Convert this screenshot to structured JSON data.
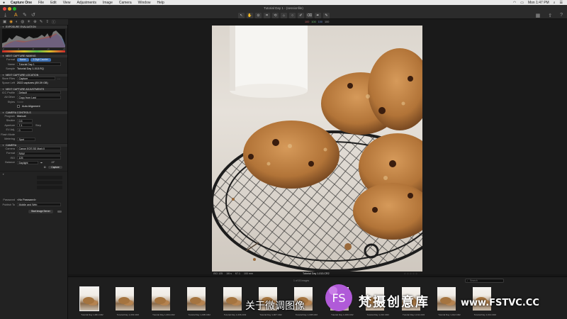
{
  "menubar": {
    "app_name": "Capture One",
    "items": [
      "File",
      "Edit",
      "View",
      "Adjustments",
      "Image",
      "Camera",
      "Window",
      "Help"
    ],
    "clock": "Mon 1:47 PM"
  },
  "window": {
    "title": "Tutorial Day 1 - (sessionfile)"
  },
  "colors": {
    "accent": "#f0a02a",
    "close": "#e0443e",
    "minimize": "#dea123",
    "zoom": "#1aab29",
    "format_pill": "#3c6fb3"
  },
  "viewer": {
    "readout": [
      "100",
      "100",
      "100",
      "100"
    ],
    "photo_meta": [
      "ISO 125",
      "1/6 s",
      "f/7.1",
      "100 mm"
    ],
    "filename": "Tutorial Day 1-013.CR2",
    "rating": "☆☆☆☆☆"
  },
  "left_panel": {
    "exposure_evaluation": "EXPOSURE EVALUATION",
    "hist_scale": [
      "-2",
      "-1",
      "0",
      "+1",
      "+2"
    ],
    "next_capture_naming": {
      "title": "NEXT CAPTURE NAMING",
      "format_label": "Format",
      "format_pill_1": "Name",
      "format_pill_2": "3 Digit Counter",
      "name_label": "Name",
      "name_value": "Tutorial Day 1",
      "sample_label": "Sample",
      "sample_value": "Tutorial Day 1-013.RQ"
    },
    "next_capture_location": {
      "title": "NEXT CAPTURE LOCATION",
      "store_label": "Store Files",
      "store_value": "Capture",
      "space_label": "Space Left",
      "space_value": "2022 captures (89.39 GB)"
    },
    "next_capture_adjustments": {
      "title": "NEXT CAPTURE ADJUSTMENTS",
      "icc_label": "ICC Profile",
      "icc_value": "Default",
      "all_other_label": "All Other",
      "all_other_value": "Copy from Last",
      "styles_label": "Styles",
      "styles_value": "None",
      "auto_alignment": "Auto Alignment"
    },
    "camera_controls": {
      "title": "CAMERA CONTROLS",
      "program_label": "Program",
      "program_value": "Manual",
      "shutter_label": "Shutter",
      "shutter_value": "0.5",
      "aperture_label": "Aperture",
      "aperture_value": "7.1",
      "step_label": "Step",
      "ev_label": "EV Adj.",
      "ev_value": "0",
      "flash_label": "Flash Mode",
      "metering_label": "Metering",
      "metering_value": "Spot"
    },
    "camera": {
      "title": "CAMERA",
      "camera_label": "Camera",
      "camera_value": "Canon EOS 5D Mark II",
      "format_label": "Format",
      "format_value": "RAW",
      "iso_label": "ISO",
      "iso_value": "125",
      "balance_label": "Balance",
      "balance_value": "Daylight",
      "af_label": "AF",
      "capture_button": "Capture"
    },
    "publish": {
      "password_label": "Password",
      "password_value": "<No Password>",
      "publish_label": "Publish To",
      "publish_value": "Mobile and Web",
      "start_button": "Start Image Server"
    }
  },
  "filmstrip": {
    "header": "1 of 15 images",
    "search_placeholder": "Search",
    "thumbs": [
      "Tutorial Day 1-001.CR2",
      "Tutorial Day 1-003.CR2",
      "Tutorial Day 1-004.CR2",
      "Tutorial Day 1-005.CR2",
      "Tutorial Day 1-006.CR2",
      "Tutorial Day 1-007.CR2",
      "Tutorial Day 1-008.CR2",
      "Tutorial Day 1-009.CR2",
      "Tutorial Day 1-010.CR2",
      "Tutorial Day 1-011.CR2",
      "Tutorial Day 1-012.CR2",
      "Tutorial Day 1-013.CR2"
    ]
  },
  "overlay": {
    "subtitle": "关于微调图像",
    "watermark_text": "梵摄创意库",
    "watermark_url": "www.FSTVC.CC",
    "watermark_logo_letters": "FS"
  }
}
